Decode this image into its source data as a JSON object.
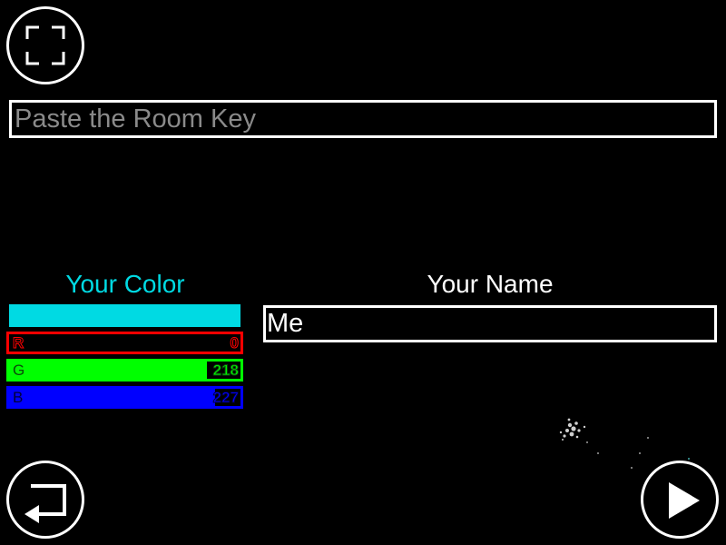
{
  "icons": {
    "fullscreen": "fullscreen-icon",
    "back": "return-arrow-icon",
    "play": "play-icon"
  },
  "room_key": {
    "value": "",
    "placeholder": "Paste the Room Key"
  },
  "color_panel": {
    "title": "Your Color",
    "swatch_color": "#00dae3",
    "channels": [
      {
        "label": "R",
        "value": "0",
        "level": 0.0,
        "color": "#ff0000"
      },
      {
        "label": "G",
        "value": "218",
        "level": 0.855,
        "color": "#00ff00"
      },
      {
        "label": "B",
        "value": "227",
        "level": 0.89,
        "color": "#0000ff"
      }
    ]
  },
  "name_panel": {
    "title": "Your Name",
    "value": "Me"
  }
}
